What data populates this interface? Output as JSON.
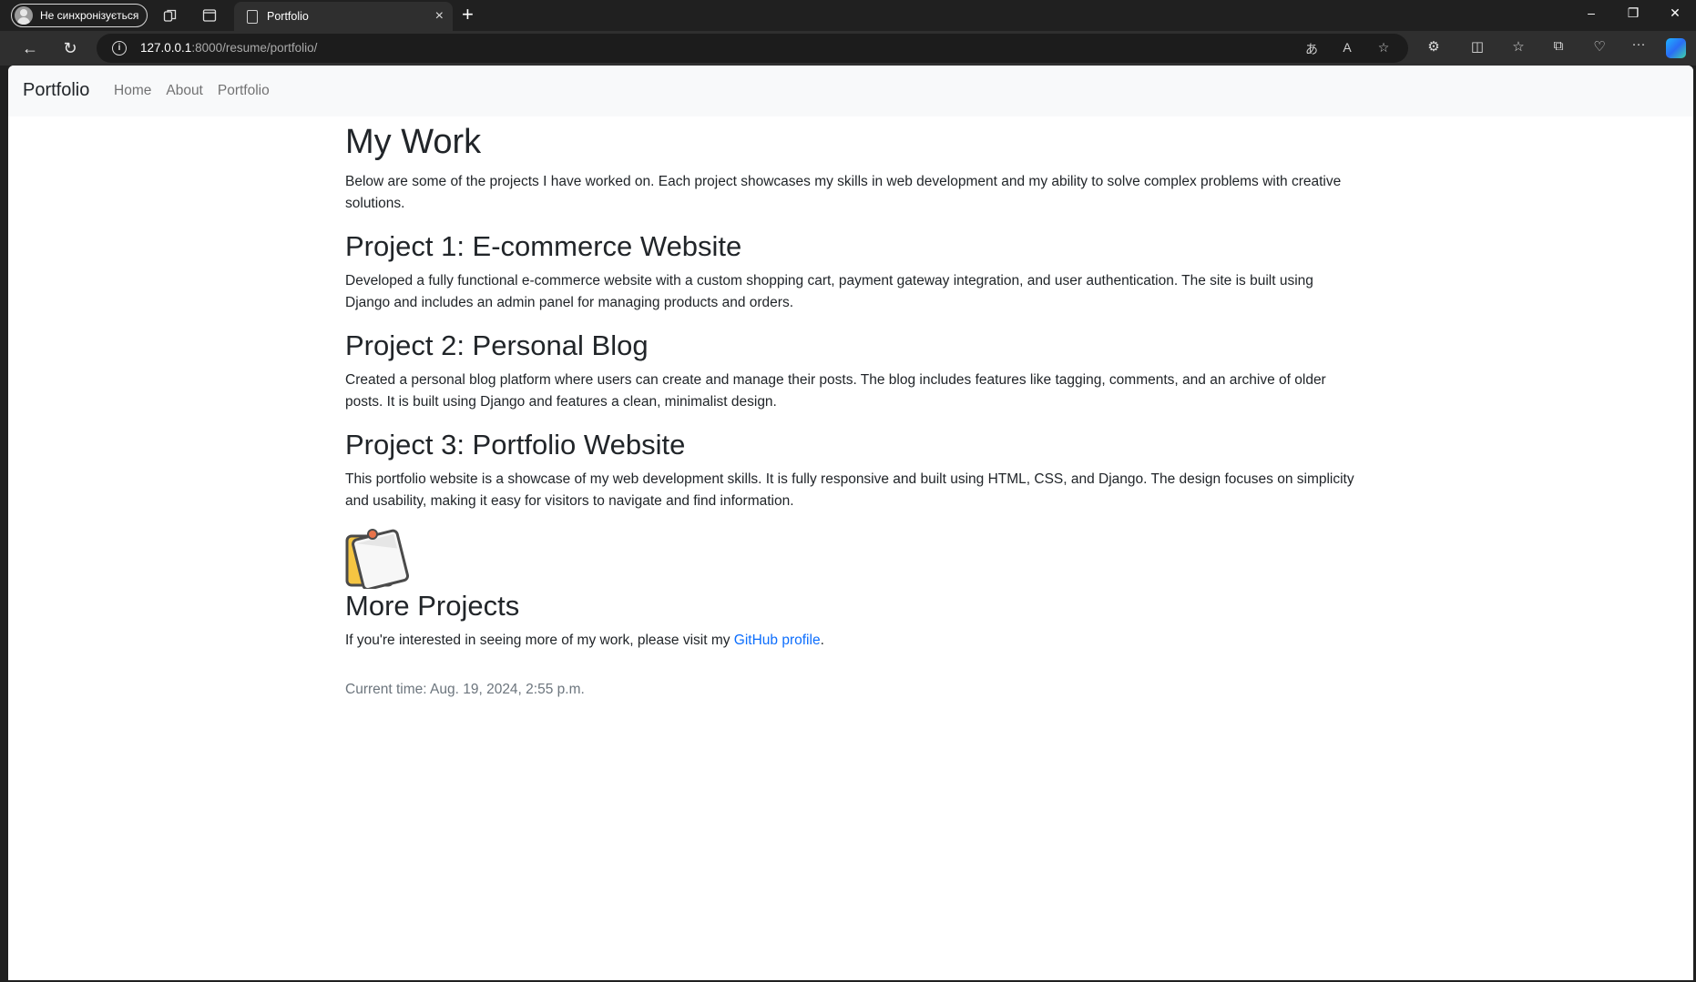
{
  "browser": {
    "profile_label": "Не синхронізується",
    "tab_title": "Portfolio",
    "url_host": "127.0.0.1",
    "url_rest": ":8000/resume/portfolio/"
  },
  "site": {
    "brand": "Portfolio",
    "nav": [
      {
        "label": "Home"
      },
      {
        "label": "About"
      },
      {
        "label": "Portfolio"
      }
    ]
  },
  "page": {
    "title": "My Work",
    "intro": "Below are some of the projects I have worked on. Each project showcases my skills in web development and my ability to solve complex problems with creative solutions.",
    "projects": [
      {
        "title": "Project 1: E-commerce Website",
        "description": "Developed a fully functional e-commerce website with a custom shopping cart, payment gateway integration, and user authentication. The site is built using Django and includes an admin panel for managing products and orders."
      },
      {
        "title": "Project 2: Personal Blog",
        "description": "Created a personal blog platform where users can create and manage their posts. The blog includes features like tagging, comments, and an archive of older posts. It is built using Django and features a clean, minimalist design."
      },
      {
        "title": "Project 3: Portfolio Website",
        "description": "This portfolio website is a showcase of my web development skills. It is fully responsive and built using HTML, CSS, and Django. The design focuses on simplicity and usability, making it easy for visitors to navigate and find information."
      }
    ],
    "more": {
      "title": "More Projects",
      "text_before": "If you're interested in seeing more of my work, please visit my ",
      "link_text": "GitHub profile",
      "text_after": "."
    },
    "current_time": "Current time: Aug. 19, 2024, 2:55 p.m."
  },
  "icons": {
    "note": "pinned-note-icon"
  },
  "colors": {
    "link": "#0d6efd",
    "navbar_bg": "#f8f9fa",
    "muted": "#6c757d"
  }
}
